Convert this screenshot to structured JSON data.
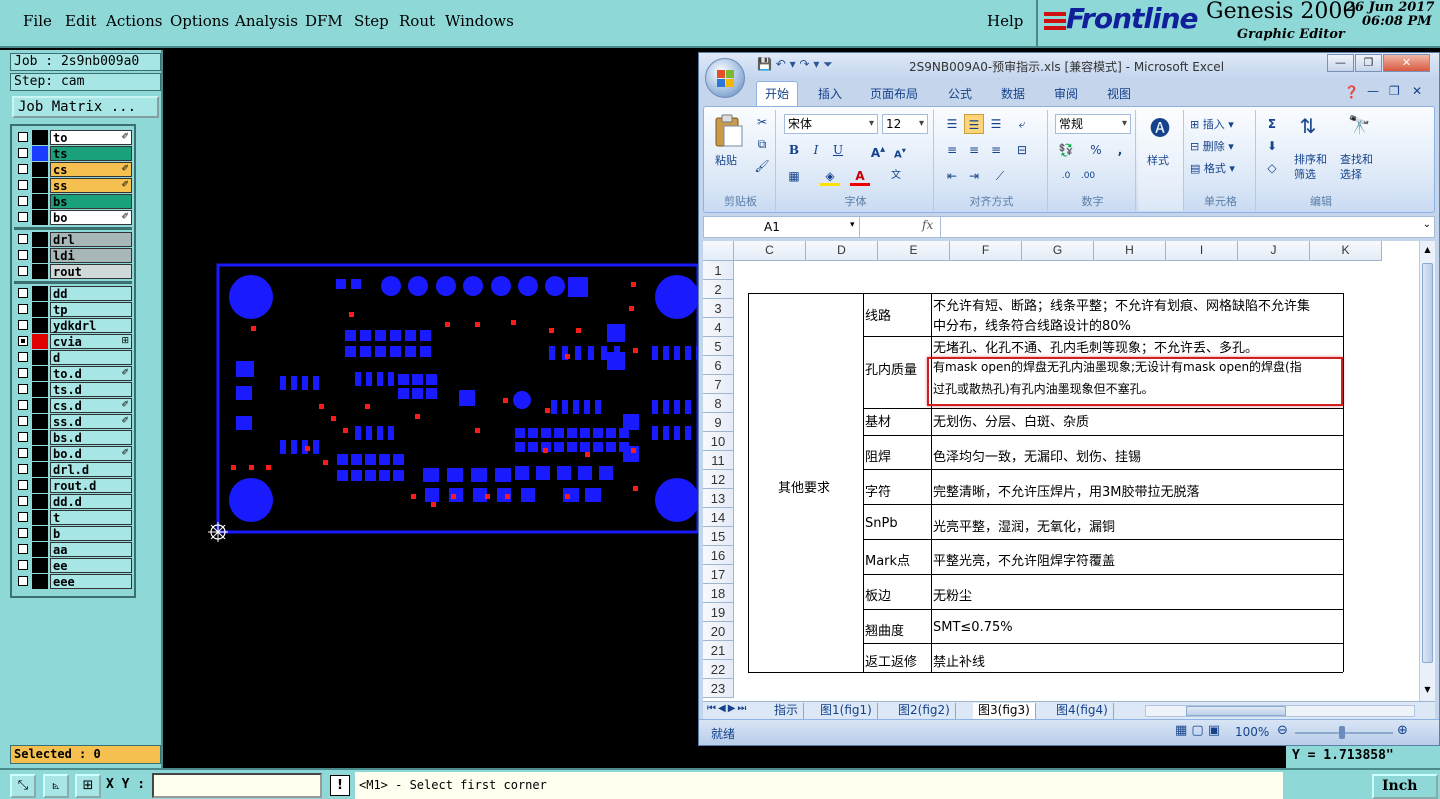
{
  "genesis": {
    "menu": [
      "File",
      "Edit",
      "Actions",
      "Options",
      "Analysis",
      "DFM",
      "Step",
      "Rout",
      "Windows"
    ],
    "help": "Help",
    "brand": "Frontline",
    "product": "Genesis 2000",
    "subproduct": "Graphic Editor",
    "date": "26 Jun 2017",
    "time": "06:08 PM",
    "job": "Job : 2s9nb009a0",
    "step": "Step: cam",
    "job_matrix": "Job Matrix ...",
    "selected": "Selected : 0",
    "xy_label": "X Y :",
    "prompt": "<M1> - Select first corner",
    "units": "Inch",
    "y_coord": "Y = 1.713858\""
  },
  "layers": [
    {
      "name": "to",
      "color": "#ffffff",
      "swatch": "#000000",
      "flag": "✐"
    },
    {
      "name": "ts",
      "color": "#1aa07a",
      "swatch": "#1a3cff",
      "flag": ""
    },
    {
      "name": "cs",
      "color": "#f5c050",
      "swatch": "#000000",
      "flag": "✐"
    },
    {
      "name": "ss",
      "color": "#f5c050",
      "swatch": "#000000",
      "flag": "✐"
    },
    {
      "name": "bs",
      "color": "#1aa07a",
      "swatch": "#000000",
      "flag": ""
    },
    {
      "name": "bo",
      "color": "#ffffff",
      "swatch": "#000000",
      "flag": "✐"
    },
    {
      "name": "drl",
      "color": "#a8b8b8",
      "swatch": "#000000",
      "flag": ""
    },
    {
      "name": "ldi",
      "color": "#a8b8b8",
      "swatch": "#000000",
      "flag": ""
    },
    {
      "name": "rout",
      "color": "#d0d8d8",
      "swatch": "#000000",
      "flag": ""
    },
    {
      "name": "dd",
      "color": "#a8e6e6",
      "swatch": "#000000",
      "flag": ""
    },
    {
      "name": "tp",
      "color": "#a8e6e6",
      "swatch": "#000000",
      "flag": ""
    },
    {
      "name": "ydkdrl",
      "color": "#a8e6e6",
      "swatch": "#000000",
      "flag": ""
    },
    {
      "name": "cvia",
      "color": "#a8e6e6",
      "swatch": "#e00000",
      "flag": "⊞",
      "checked": true
    },
    {
      "name": "d",
      "color": "#a8e6e6",
      "swatch": "#000000",
      "flag": ""
    },
    {
      "name": "to.d",
      "color": "#a8e6e6",
      "swatch": "#000000",
      "flag": "✐"
    },
    {
      "name": "ts.d",
      "color": "#a8e6e6",
      "swatch": "#000000",
      "flag": ""
    },
    {
      "name": "cs.d",
      "color": "#a8e6e6",
      "swatch": "#000000",
      "flag": "✐"
    },
    {
      "name": "ss.d",
      "color": "#a8e6e6",
      "swatch": "#000000",
      "flag": "✐"
    },
    {
      "name": "bs.d",
      "color": "#a8e6e6",
      "swatch": "#000000",
      "flag": ""
    },
    {
      "name": "bo.d",
      "color": "#a8e6e6",
      "swatch": "#000000",
      "flag": "✐"
    },
    {
      "name": "drl.d",
      "color": "#a8e6e6",
      "swatch": "#000000",
      "flag": ""
    },
    {
      "name": "rout.d",
      "color": "#a8e6e6",
      "swatch": "#000000",
      "flag": ""
    },
    {
      "name": "dd.d",
      "color": "#a8e6e6",
      "swatch": "#000000",
      "flag": ""
    },
    {
      "name": "t",
      "color": "#a8e6e6",
      "swatch": "#000000",
      "flag": ""
    },
    {
      "name": "b",
      "color": "#a8e6e6",
      "swatch": "#000000",
      "flag": ""
    },
    {
      "name": "aa",
      "color": "#a8e6e6",
      "swatch": "#000000",
      "flag": ""
    },
    {
      "name": "ee",
      "color": "#a8e6e6",
      "swatch": "#000000",
      "flag": ""
    },
    {
      "name": "eee",
      "color": "#a8e6e6",
      "swatch": "#000000",
      "flag": ""
    }
  ],
  "excel": {
    "title": "2S9NB009A0-预审指示.xls  [兼容模式] - Microsoft Excel",
    "tabs": [
      "开始",
      "插入",
      "页面布局",
      "公式",
      "数据",
      "审阅",
      "视图"
    ],
    "groups": {
      "clipboard": "剪贴板",
      "font": "字体",
      "alignment": "对齐方式",
      "number": "数字",
      "styles": "样式",
      "cells": "单元格",
      "editing": "编辑"
    },
    "paste": "粘贴",
    "font_name": "宋体",
    "font_size": "12",
    "number_format": "常规",
    "insert": "插入",
    "delete": "删除",
    "format": "格式",
    "sort_filter": "排序和筛选",
    "find_select": "查找和选择",
    "name_box": "A1",
    "fx": "fx",
    "columns": [
      "C",
      "D",
      "E",
      "F",
      "G",
      "H",
      "I",
      "J",
      "K"
    ],
    "rows": [
      "1",
      "2",
      "3",
      "4",
      "5",
      "6",
      "7",
      "8",
      "9",
      "10",
      "11",
      "12",
      "13",
      "14",
      "15",
      "16",
      "17",
      "18",
      "19",
      "20",
      "21",
      "22",
      "23"
    ],
    "merged_label": "其他要求",
    "items": [
      {
        "label": "线路",
        "lines": [
          "不允许有短、断路；线条平整；不允许有划痕、网格缺陷不允许集",
          "中分布，线条符合线路设计的80%"
        ]
      },
      {
        "label": "孔内质量",
        "lines": [
          "无堵孔、化孔不通、孔内毛刺等现象；不允许丢、多孔。",
          "有mask open的焊盘无孔内油墨现象;无设计有mask open的焊盘(指",
          "过孔或散热孔)有孔内油墨现象但不塞孔。"
        ]
      },
      {
        "label": "基材",
        "lines": [
          "无划伤、分层、白斑、杂质"
        ]
      },
      {
        "label": "阻焊",
        "lines": [
          "色泽均匀一致，无漏印、划伤、挂锡"
        ]
      },
      {
        "label": "字符",
        "lines": [
          "完整清晰，不允许压焊片，用3M胶带拉无脱落"
        ]
      },
      {
        "label": "SnPb",
        "lines": [
          "光亮平整，湿润，无氧化，漏铜"
        ]
      },
      {
        "label": "Mark点",
        "lines": [
          "平整光亮，不允许阻焊字符覆盖"
        ]
      },
      {
        "label": "板边",
        "lines": [
          "无粉尘"
        ]
      },
      {
        "label": "翘曲度",
        "lines": [
          "SMT≤0.75%"
        ]
      },
      {
        "label": "返工返修",
        "lines": [
          "禁止补线"
        ]
      }
    ],
    "sheets": [
      "指示",
      "图1(fig1)",
      "图2(fig2)",
      "图3(fig3)",
      "图4(fig4)"
    ],
    "active_sheet": 3,
    "status": "就绪",
    "zoom": "100%"
  },
  "colors": {
    "genesis_bg": "#8fd8d8",
    "pcb_copper": "#1a1aff",
    "pcb_via": "#ff1a1a",
    "highlight": "#d02020"
  }
}
